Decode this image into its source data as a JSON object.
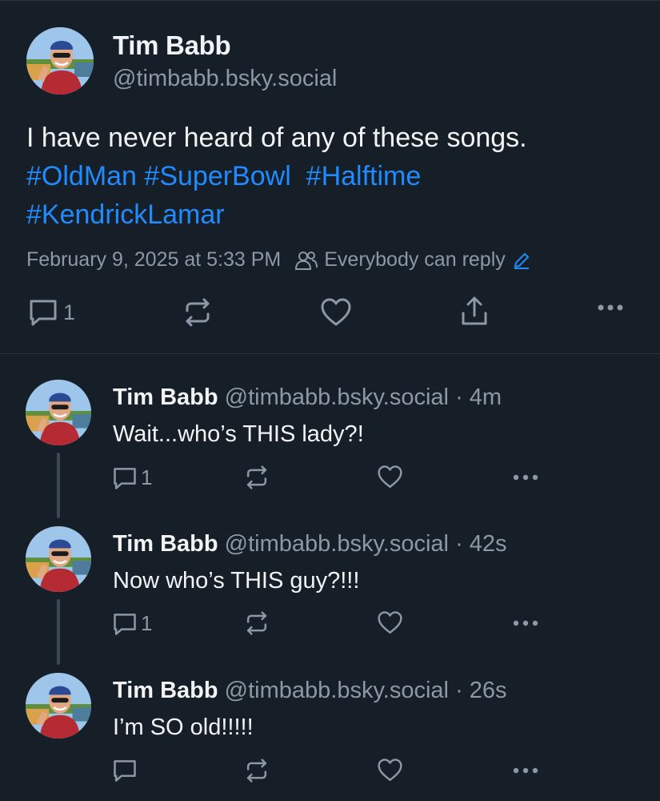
{
  "colors": {
    "background": "#161e27",
    "text": "#f1f3f5",
    "muted": "#8b98a6",
    "link": "#208bfe",
    "divider": "#2a3542"
  },
  "main_post": {
    "author_name": "Tim Babb",
    "author_handle": "@timbabb.bsky.social",
    "text": "I have never heard of any of these songs.",
    "hashtags_line1": [
      "#OldMan",
      "#SuperBowl",
      "#Halftime"
    ],
    "hashtags_line2": [
      "#KendrickLamar"
    ],
    "timestamp": "February 9, 2025 at 5:33 PM",
    "reply_setting": "Everybody can reply",
    "reply_count": "1"
  },
  "replies": [
    {
      "author_name": "Tim Babb",
      "author_handle": "@timbabb.bsky.social",
      "age": "4m",
      "text": "Wait...who’s THIS lady?!",
      "reply_count": "1"
    },
    {
      "author_name": "Tim Babb",
      "author_handle": "@timbabb.bsky.social",
      "age": "42s",
      "text": "Now who’s THIS guy?!!!",
      "reply_count": "1"
    },
    {
      "author_name": "Tim Babb",
      "author_handle": "@timbabb.bsky.social",
      "age": "26s",
      "text": "I’m SO old!!!!!",
      "reply_count": ""
    }
  ],
  "icons": [
    "reply-icon",
    "repost-icon",
    "like-icon",
    "share-icon",
    "more-icon",
    "people-icon",
    "pencil-icon"
  ]
}
